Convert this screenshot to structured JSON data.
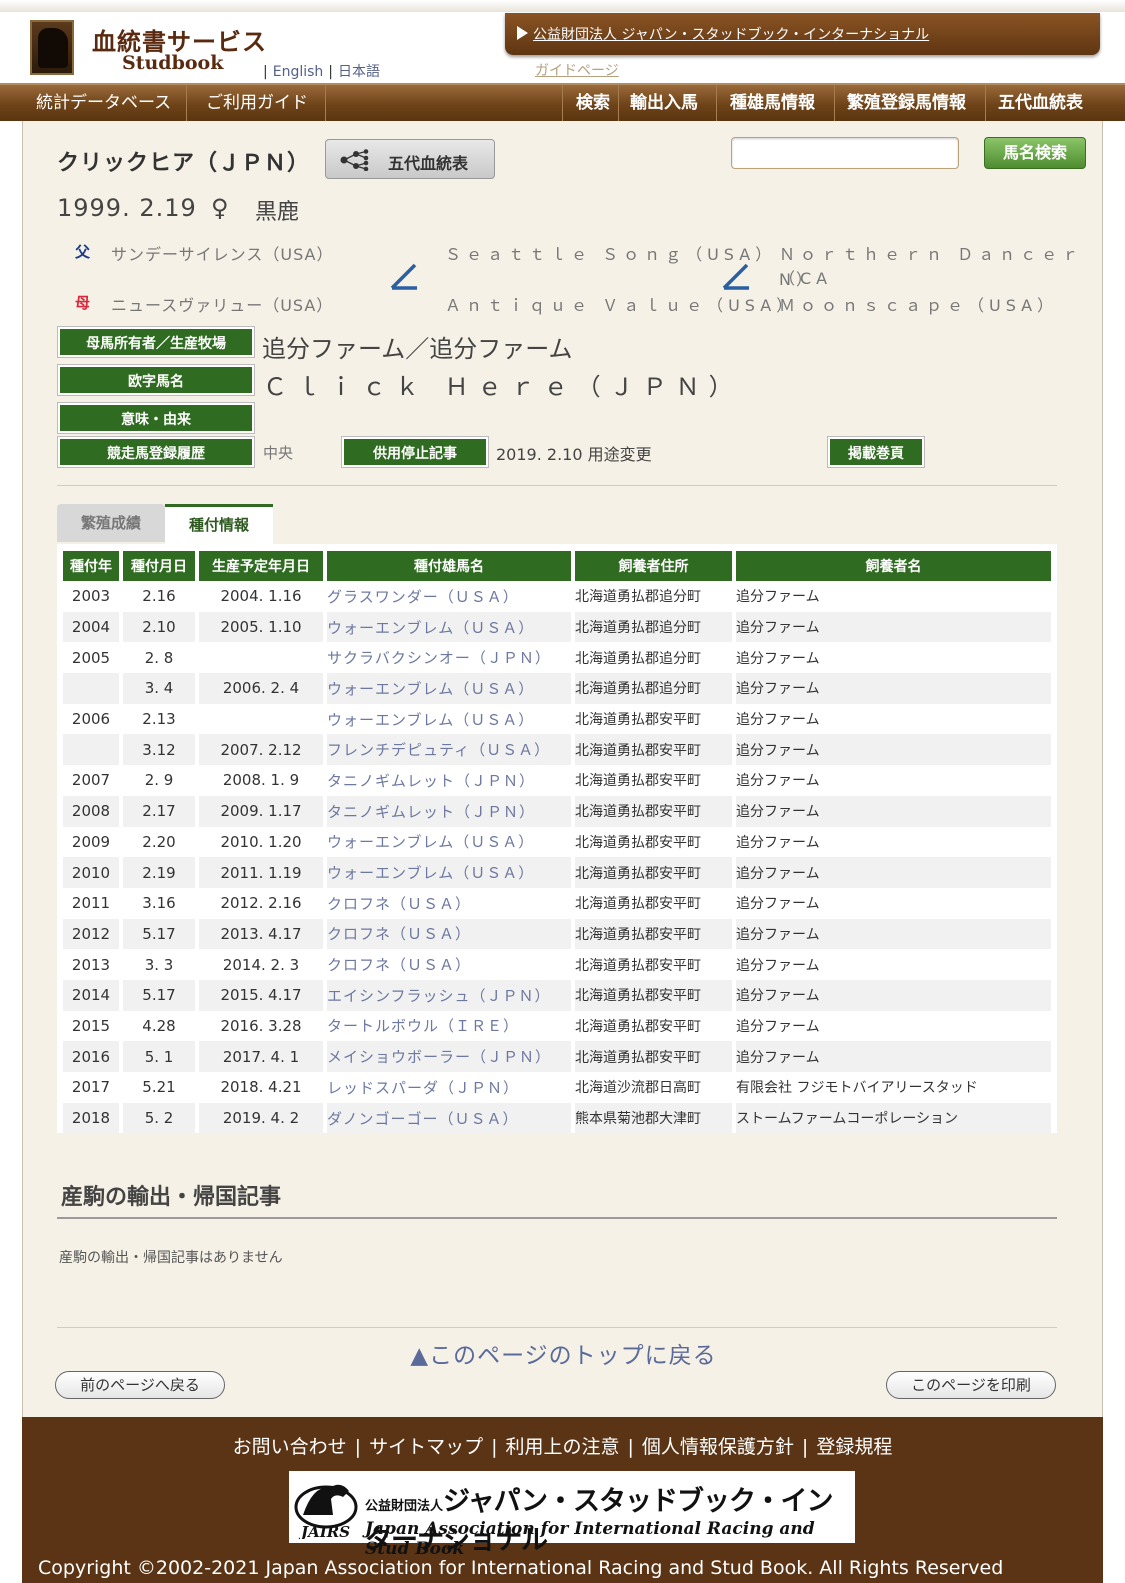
{
  "header": {
    "logo_title": "血統書サービス",
    "logo_sub": "Studbook",
    "lang_english": "English",
    "lang_japanese": "日本語",
    "lang_sep": "|",
    "jairs_link": "公益財団法人 ジャパン・スタッドブック・インターナショナル",
    "guide_link": "ガイドページ"
  },
  "nav": {
    "left": [
      "統計データベース",
      "ご利用ガイド"
    ],
    "right": [
      "検索",
      "輸出入馬",
      "種雄馬情報",
      "繁殖登録馬情報",
      "五代血統表"
    ]
  },
  "horse": {
    "name": "クリックヒア（ＪＰＮ）",
    "pedigree_button": "五代血統表",
    "search_button": "馬名検索",
    "search_value": "",
    "birth": "1999. 2.19",
    "sex": "♀",
    "color": "黒鹿"
  },
  "pedigree": {
    "sire_key": "父",
    "dam_key": "母",
    "sire": "サンデーサイレンス（USA）",
    "dam": "ニュースヴァリュー（USA）",
    "sire_sire": "Ｓｅａｔｔｌｅ Ｓｏｎｇ（USA）",
    "sire_dam": "Ｎｏｒｔｈｅｒｎ Ｄａｎｃｅｒ（CA",
    "sire_dam_wrap": "N）",
    "dam_sire": "Ａｎｔｉｑｕｅ Ｖａｌｕｅ（USA）",
    "dam_dam": "Ｍｏｏｎｓｃａｐｅ（USA）"
  },
  "info": {
    "owner_label": "母馬所有者／生産牧場",
    "owner_value": "追分ファーム／追分ファーム",
    "roman_label": "欧字馬名",
    "roman_value": "Ｃｌｉｃｋ Ｈｅｒｅ（ＪＰＮ）",
    "meaning_label": "意味・由来",
    "meaning_value": "",
    "race_label": "競走馬登録履歴",
    "race_value": "中央",
    "stop_label": "供用停止記事",
    "stop_value": "2019. 2.10 用途変更",
    "volume_label": "掲載巻頁"
  },
  "tabs": {
    "breeding_results": "繁殖成績",
    "mating_info": "種付情報"
  },
  "table": {
    "headers": [
      "種付年",
      "種付月日",
      "生産予定年月日",
      "種付雄馬名",
      "飼養者住所",
      "飼養者名"
    ],
    "rows": [
      [
        "2003",
        "2.16",
        "2004. 1.16",
        "グラスワンダー（ＵＳＡ）",
        "北海道勇払郡追分町",
        "追分ファーム"
      ],
      [
        "2004",
        "2.10",
        "2005. 1.10",
        "ウォーエンブレム（ＵＳＡ）",
        "北海道勇払郡追分町",
        "追分ファーム"
      ],
      [
        "2005",
        "2. 8",
        "",
        "サクラバクシンオー（ＪＰＮ）",
        "北海道勇払郡追分町",
        "追分ファーム"
      ],
      [
        "",
        "3. 4",
        "2006. 2. 4",
        "ウォーエンブレム（ＵＳＡ）",
        "北海道勇払郡追分町",
        "追分ファーム"
      ],
      [
        "2006",
        "2.13",
        "",
        "ウォーエンブレム（ＵＳＡ）",
        "北海道勇払郡安平町",
        "追分ファーム"
      ],
      [
        "",
        "3.12",
        "2007. 2.12",
        "フレンチデピュティ（ＵＳＡ）",
        "北海道勇払郡安平町",
        "追分ファーム"
      ],
      [
        "2007",
        "2. 9",
        "2008. 1. 9",
        "タニノギムレット（ＪＰＮ）",
        "北海道勇払郡安平町",
        "追分ファーム"
      ],
      [
        "2008",
        "2.17",
        "2009. 1.17",
        "タニノギムレット（ＪＰＮ）",
        "北海道勇払郡安平町",
        "追分ファーム"
      ],
      [
        "2009",
        "2.20",
        "2010. 1.20",
        "ウォーエンブレム（ＵＳＡ）",
        "北海道勇払郡安平町",
        "追分ファーム"
      ],
      [
        "2010",
        "2.19",
        "2011. 1.19",
        "ウォーエンブレム（ＵＳＡ）",
        "北海道勇払郡安平町",
        "追分ファーム"
      ],
      [
        "2011",
        "3.16",
        "2012. 2.16",
        "クロフネ（ＵＳＡ）",
        "北海道勇払郡安平町",
        "追分ファーム"
      ],
      [
        "2012",
        "5.17",
        "2013. 4.17",
        "クロフネ（ＵＳＡ）",
        "北海道勇払郡安平町",
        "追分ファーム"
      ],
      [
        "2013",
        "3. 3",
        "2014. 2. 3",
        "クロフネ（ＵＳＡ）",
        "北海道勇払郡安平町",
        "追分ファーム"
      ],
      [
        "2014",
        "5.17",
        "2015. 4.17",
        "エイシンフラッシュ（ＪＰＮ）",
        "北海道勇払郡安平町",
        "追分ファーム"
      ],
      [
        "2015",
        "4.28",
        "2016. 3.28",
        "タートルボウル（ＩＲＥ）",
        "北海道勇払郡安平町",
        "追分ファーム"
      ],
      [
        "2016",
        "5. 1",
        "2017. 4. 1",
        "メイショウボーラー（ＪＰＮ）",
        "北海道勇払郡安平町",
        "追分ファーム"
      ],
      [
        "2017",
        "5.21",
        "2018. 4.21",
        "レッドスパーダ（ＪＰＮ）",
        "北海道沙流郡日高町",
        "有限会社 フジモトバイアリースタッド"
      ],
      [
        "2018",
        "5. 2",
        "2019. 4. 2",
        "ダノンゴーゴー（ＵＳＡ）",
        "熊本県菊池郡大津町",
        "ストームファームコーポレーション"
      ]
    ]
  },
  "export": {
    "heading": "産駒の輸出・帰国記事",
    "body": "産駒の輸出・帰国記事はありません"
  },
  "page_nav": {
    "back_to_top": "▲このページのトップに戻る",
    "prev_page": "前のページへ戻る",
    "print_page": "このページを印刷"
  },
  "footer": {
    "links": [
      "お問い合わせ",
      "サイトマップ",
      "利用上の注意",
      "個人情報保護方針",
      "登録規程"
    ],
    "sep": "|",
    "logo_jp_small": "公益財団法人",
    "logo_jp": "ジャパン・スタッドブック・インターナショナル",
    "logo_abbr": "JAIRS",
    "logo_en": "Japan Association for International Racing and Stud Book",
    "copyright": "Copyright ©2002-2021 Japan Association for International Racing and Stud Book. All Rights Reserved"
  },
  "colors": {
    "brown_nav": "#6e4318",
    "green_label": "#2f6b20",
    "sire_blue": "#1a3a8a",
    "dam_red": "#d8283c",
    "link_gray_blue": "#6d78a0"
  }
}
